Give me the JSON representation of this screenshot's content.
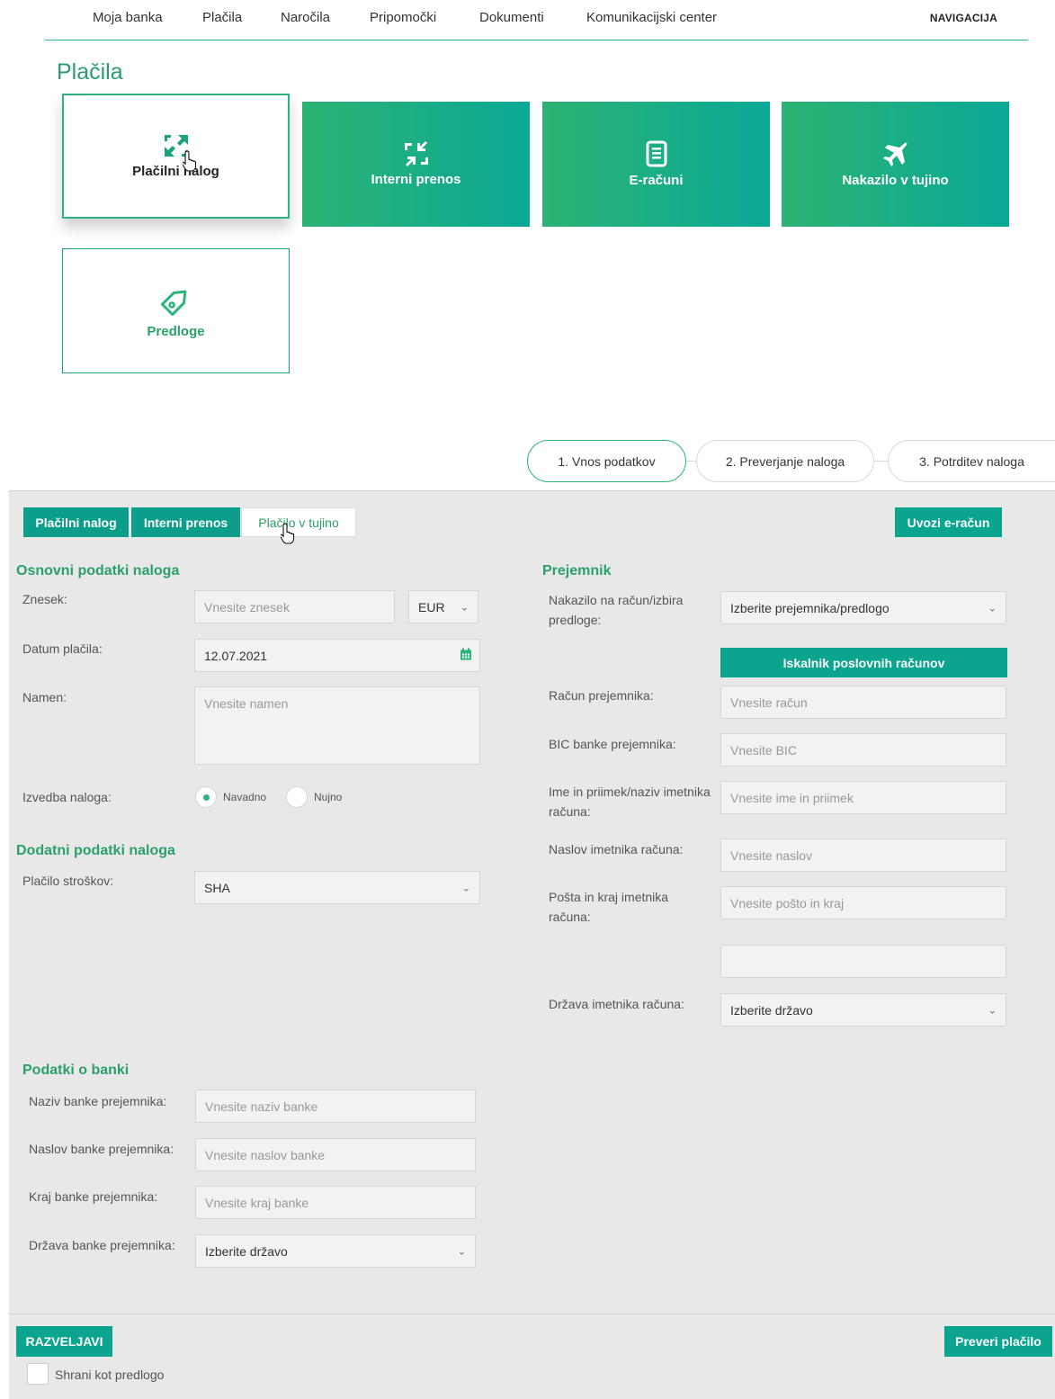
{
  "nav": {
    "items": [
      "Moja banka",
      "Plačila",
      "Naročila",
      "Pripomočki",
      "Dokumenti",
      "Komunikacijski center"
    ],
    "navigation_label": "NAVIGACIJA"
  },
  "page_title": "Plačila",
  "tiles": [
    {
      "label": "Plačilni nalog",
      "icon": "expand-arrows-icon",
      "state": "selected"
    },
    {
      "label": "Interni prenos",
      "icon": "compress-arrows-icon"
    },
    {
      "label": "E-računi",
      "icon": "document-list-icon"
    },
    {
      "label": "Nakazilo v tujino",
      "icon": "airplane-icon"
    },
    {
      "label": "Predloge",
      "icon": "tag-icon"
    }
  ],
  "steps": [
    "1. Vnos podatkov",
    "2. Preverjanje naloga",
    "3. Potrditev naloga"
  ],
  "tabs": [
    "Plačilni nalog",
    "Interni prenos",
    "Plačilo v tujino"
  ],
  "import_button": "Uvozi e-račun",
  "basic": {
    "title": "Osnovni podatki naloga",
    "amount_label": "Znesek:",
    "amount_placeholder": "Vnesite znesek",
    "currency": "EUR",
    "date_label": "Datum plačila:",
    "date_value": "12.07.2021",
    "purpose_label": "Namen:",
    "purpose_placeholder": "Vnesite namen",
    "execution_label": "Izvedba naloga:",
    "execution_options": [
      "Navadno",
      "Nujno"
    ],
    "execution_selected": "Navadno"
  },
  "additional": {
    "title": "Dodatni podatki naloga",
    "costs_label": "Plačilo stroškov:",
    "costs_value": "SHA"
  },
  "recipient": {
    "title": "Prejemnik",
    "transfer_label": "Nakazilo na račun/izbira predloge:",
    "transfer_value": "Izberite prejemnika/predlogo",
    "search_button": "Iskalnik poslovnih računov",
    "account_label": "Račun prejemnika:",
    "account_placeholder": "Vnesite račun",
    "bic_label": "BIC banke prejemnika:",
    "bic_placeholder": "Vnesite BIC",
    "name_label": "Ime in priimek/naziv imetnika računa:",
    "name_placeholder": "Vnesite ime in priimek",
    "address_label": "Naslov imetnika računa:",
    "address_placeholder": "Vnesite naslov",
    "post_label": "Pošta in kraj imetnika računa:",
    "post_placeholder": "Vnesite pošto in kraj",
    "extra_value": "",
    "country_label": "Država imetnika računa:",
    "country_value": "Izberite državo"
  },
  "bank": {
    "title": "Podatki o banki",
    "name_label": "Naziv banke prejemnika:",
    "name_placeholder": "Vnesite naziv banke",
    "address_label": "Naslov banke prejemnika:",
    "address_placeholder": "Vnesite naslov banke",
    "city_label": "Kraj banke prejemnika:",
    "city_placeholder": "Vnesite kraj banke",
    "country_label": "Država banke prejemnika:",
    "country_value": "Izberite državo"
  },
  "footer": {
    "reset_button": "RAZVELJAVI",
    "save_template_label": "Shrani kot predlogo",
    "check_button": "Preveri plačilo"
  },
  "colors": {
    "accent": "#2bb47c",
    "teal": "#0ba58f",
    "panel_bg": "#e8e8e9"
  }
}
